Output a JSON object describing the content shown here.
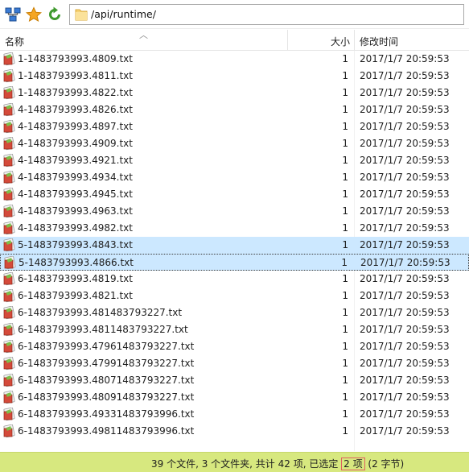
{
  "toolbar": {
    "icons": [
      "network-icon",
      "star-icon",
      "refresh-icon"
    ],
    "path": "/api/runtime/"
  },
  "header": {
    "name_label": "名称",
    "size_label": "大小",
    "time_label": "修改时间"
  },
  "files": [
    {
      "name": "1-1483793993.4809.txt",
      "size": "1",
      "time": "2017/1/7 20:59:53"
    },
    {
      "name": "1-1483793993.4811.txt",
      "size": "1",
      "time": "2017/1/7 20:59:53"
    },
    {
      "name": "1-1483793993.4822.txt",
      "size": "1",
      "time": "2017/1/7 20:59:53"
    },
    {
      "name": "4-1483793993.4826.txt",
      "size": "1",
      "time": "2017/1/7 20:59:53"
    },
    {
      "name": "4-1483793993.4897.txt",
      "size": "1",
      "time": "2017/1/7 20:59:53"
    },
    {
      "name": "4-1483793993.4909.txt",
      "size": "1",
      "time": "2017/1/7 20:59:53"
    },
    {
      "name": "4-1483793993.4921.txt",
      "size": "1",
      "time": "2017/1/7 20:59:53"
    },
    {
      "name": "4-1483793993.4934.txt",
      "size": "1",
      "time": "2017/1/7 20:59:53"
    },
    {
      "name": "4-1483793993.4945.txt",
      "size": "1",
      "time": "2017/1/7 20:59:53"
    },
    {
      "name": "4-1483793993.4963.txt",
      "size": "1",
      "time": "2017/1/7 20:59:53"
    },
    {
      "name": "4-1483793993.4982.txt",
      "size": "1",
      "time": "2017/1/7 20:59:53"
    },
    {
      "name": "5-1483793993.4843.txt",
      "size": "1",
      "time": "2017/1/7 20:59:53",
      "selected": true
    },
    {
      "name": "5-1483793993.4866.txt",
      "size": "1",
      "time": "2017/1/7 20:59:53",
      "selected": true,
      "focused": true
    },
    {
      "name": "6-1483793993.4819.txt",
      "size": "1",
      "time": "2017/1/7 20:59:53"
    },
    {
      "name": "6-1483793993.4821.txt",
      "size": "1",
      "time": "2017/1/7 20:59:53"
    },
    {
      "name": "6-1483793993.481483793227.txt",
      "size": "1",
      "time": "2017/1/7 20:59:53"
    },
    {
      "name": "6-1483793993.4811483793227.txt",
      "size": "1",
      "time": "2017/1/7 20:59:53"
    },
    {
      "name": "6-1483793993.47961483793227.txt",
      "size": "1",
      "time": "2017/1/7 20:59:53"
    },
    {
      "name": "6-1483793993.47991483793227.txt",
      "size": "1",
      "time": "2017/1/7 20:59:53"
    },
    {
      "name": "6-1483793993.48071483793227.txt",
      "size": "1",
      "time": "2017/1/7 20:59:53"
    },
    {
      "name": "6-1483793993.48091483793227.txt",
      "size": "1",
      "time": "2017/1/7 20:59:53"
    },
    {
      "name": "6-1483793993.49331483793996.txt",
      "size": "1",
      "time": "2017/1/7 20:59:53"
    },
    {
      "name": "6-1483793993.49811483793996.txt",
      "size": "1",
      "time": "2017/1/7 20:59:53"
    }
  ],
  "status": {
    "prefix": "39 个文件, 3 个文件夹, 共计 42 项, 已选定 ",
    "selected_count": "2 项",
    "suffix": " (2 字节)"
  },
  "colors": {
    "selection": "#cce8ff",
    "status_bg": "#d7e87f"
  }
}
